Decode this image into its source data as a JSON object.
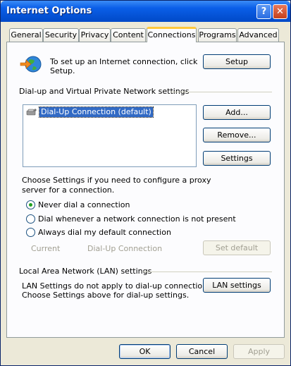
{
  "window": {
    "title": "Internet Options",
    "help_symbol": "?",
    "close_symbol": "✕"
  },
  "tabs": [
    {
      "label": "General"
    },
    {
      "label": "Security"
    },
    {
      "label": "Privacy"
    },
    {
      "label": "Content"
    },
    {
      "label": "Connections",
      "active": true
    },
    {
      "label": "Programs"
    },
    {
      "label": "Advanced"
    }
  ],
  "setup": {
    "text_line1": "To set up an Internet connection, click",
    "text_line2": "Setup.",
    "button": "Setup"
  },
  "dialup": {
    "group_label": "Dial-up and Virtual Private Network settings",
    "items": [
      {
        "label": "Dial-Up Connection (default)",
        "selected": true
      }
    ],
    "add_button": "Add...",
    "remove_button": "Remove...",
    "settings_button": "Settings",
    "proxy_text_line1": "Choose Settings if you need to configure a proxy",
    "proxy_text_line2": "server for a connection.",
    "options": [
      {
        "label": "Never dial a connection",
        "checked": true
      },
      {
        "label": "Dial whenever a network connection is not present",
        "checked": false
      },
      {
        "label": "Always dial my default connection",
        "checked": false
      }
    ],
    "current_label": "Current",
    "current_value": "Dial-Up Connection",
    "set_default_button": "Set default"
  },
  "lan": {
    "group_label": "Local Area Network (LAN) settings",
    "text_line1": "LAN Settings do not apply to dial-up connections.",
    "text_line2": "Choose Settings above for dial-up settings.",
    "button": "LAN settings"
  },
  "footer": {
    "ok": "OK",
    "cancel": "Cancel",
    "apply": "Apply"
  },
  "colors": {
    "title_bar": "#0553d6",
    "active_tab_accent": "#ffc83c",
    "selection": "#316ac5",
    "radio_dot": "#21a121"
  }
}
